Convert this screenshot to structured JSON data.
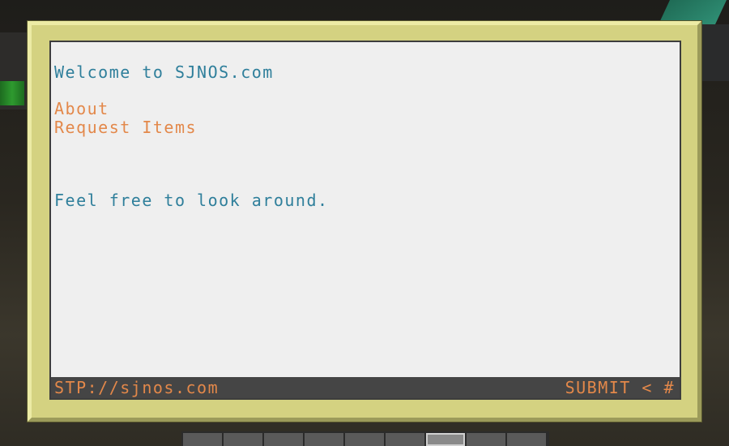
{
  "screen": {
    "welcome_text": "Welcome to SJNOS.com",
    "nav_links": [
      {
        "label": "About"
      },
      {
        "label": "Request Items"
      }
    ],
    "body_text": "Feel free to look around."
  },
  "status_bar": {
    "address": "STP://sjnos.com",
    "submit_label": "SUBMIT < #"
  },
  "colors": {
    "frame": "#d4d281",
    "screen_background": "#efefef",
    "text_teal": "#2f7f9b",
    "text_orange": "#e3884a",
    "status_bar_background": "#454545"
  }
}
